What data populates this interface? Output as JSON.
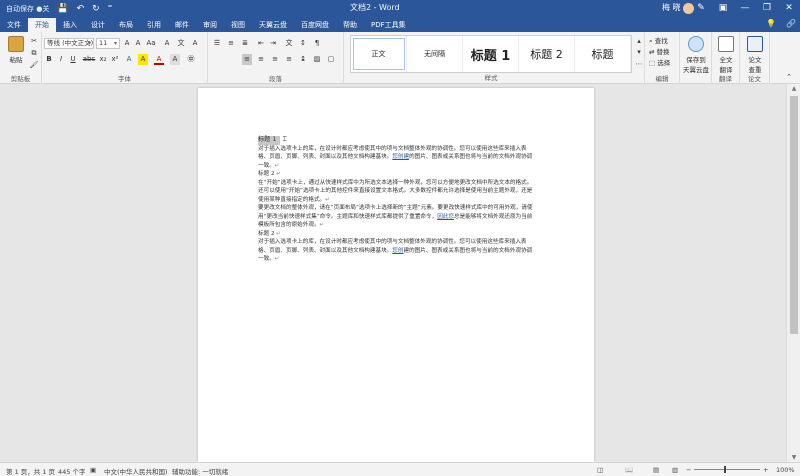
{
  "titlebar": {
    "autosave": "自动保存 ●关",
    "save_icon": "save-icon",
    "undo_icon": "undo-icon",
    "redo_icon": "redo-icon",
    "customize": "⁼",
    "doc_title": "文档2 - Word",
    "user": "梅 晓",
    "minimize": "—",
    "restore": "❐",
    "close": "✕"
  },
  "tabs": [
    "文件",
    "开始",
    "插入",
    "设计",
    "布局",
    "引用",
    "邮件",
    "审阅",
    "视图",
    "天翼云盘",
    "百度网盘",
    "帮助",
    "PDF工具集"
  ],
  "active_tab": "开始",
  "tabbar_right": {
    "lightbulb": "💡",
    "share": "🔗"
  },
  "ribbon": {
    "clipboard": {
      "paste": "粘贴",
      "label": "剪贴板"
    },
    "font": {
      "name": "等线 (中文正文)",
      "size": "11",
      "label": "字体",
      "buttons": [
        "B",
        "I",
        "U",
        "abc",
        "x₂",
        "x²",
        "A",
        "A",
        "A",
        "A"
      ]
    },
    "paragraph": {
      "label": "段落"
    },
    "styles": {
      "items": [
        "正文",
        "无间隔",
        "标题 1",
        "标题 2",
        "标题"
      ],
      "label": "样式"
    },
    "editing": {
      "find": "查找",
      "replace": "替换",
      "select": "选择",
      "label": "编辑"
    },
    "cloud": {
      "save": "保存到",
      "save2": "天翼云盘"
    },
    "addins": [
      {
        "l1": "全文",
        "l2": "翻译",
        "l3": "翻译"
      },
      {
        "l1": "论文",
        "l2": "查重",
        "l3": "论文"
      }
    ]
  },
  "document": {
    "heading1": "标题 1",
    "para1": "对于插入选项卡上的库，在设计时都应考虑使其中的项与文档整体外观的协调性。您可以使用这些库来插入表格、页眉、页脚、列表、封面以及其他文档构建基块。",
    "para1_link": "您创建",
    "para1_tail": "的图片、图表或关系图也将与当前的文档外观协调一致。",
    "heading2a": "标题 2",
    "para2": "在“开始”选项卡上，通过从快速样式库中为所选文本选择一种外观，您可以方便地更改文档中所选文本的格式。还可以使用“开始”选项卡上的其他控件来直接设置文本格式。大多数控件都允许选择是使用当前主题外观，还是使用某种直接指定的格式。",
    "para3": "要更改文档的整体外观，请在“页面布局”选项卡上选择新的“主题”元素。要更改快速样式库中的可用外观，请使用“更改当前快速样式集”命令。主题库和快速样式库都提供了重置命令，",
    "para3_link": "因此您",
    "para3_tail": "总是能够将文档外观还原为当前模板所包含的原始外观。",
    "heading2b": "标题 2",
    "para4": "对于插入选项卡上的库，在设计时都应考虑使其中的项与文档整体外观的协调性。您可以使用这些库来插入表格、页眉、页脚、列表、封面以及其他文档构建基块。",
    "para4_link": "您创",
    "para4_tail": "建的图片、图表或关系图也将与当前的文档外观协调一致。"
  },
  "statusbar": {
    "page": "第 1 页，共 1 页",
    "words": "445 个字",
    "lang": "中文(中华人民共和国)",
    "accessibility": "辅助功能: 一切就绪",
    "zoom": "100%"
  }
}
